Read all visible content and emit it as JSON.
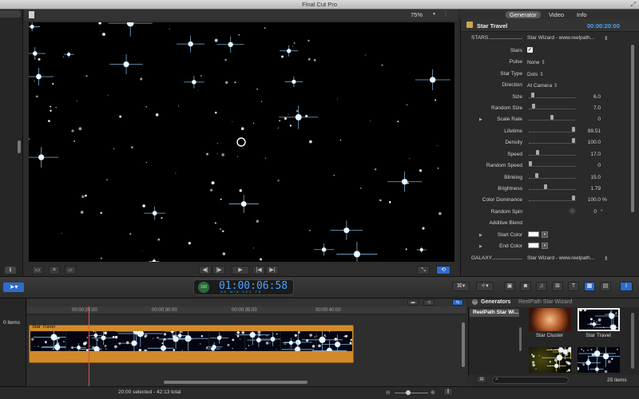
{
  "window": {
    "title": "Final Cut Pro"
  },
  "viewer": {
    "zoom": "75%"
  },
  "inspector": {
    "tabs": [
      {
        "label": "Generator",
        "active": true
      },
      {
        "label": "Video",
        "active": false
      },
      {
        "label": "Info",
        "active": false
      }
    ],
    "title": "Star Travel",
    "timecode": "00:00:20:00",
    "stars_section": {
      "label": "STARS",
      "value": "Star Wizard - www.reelpath..."
    },
    "galaxy_section": {
      "label": "GALAXY",
      "value": "Star Wizard - www.reelpath..."
    },
    "params": {
      "stars": {
        "label": "Stars",
        "checked": true
      },
      "pulse": {
        "label": "Pulse",
        "value": "None"
      },
      "star_type": {
        "label": "Star Type",
        "value": "Dots"
      },
      "direction": {
        "label": "Direction",
        "value": "At Camera"
      },
      "size": {
        "label": "Size",
        "value": "6.0",
        "fraction": 0.06
      },
      "random_size": {
        "label": "Random Size",
        "value": "7.0",
        "fraction": 0.07
      },
      "scale_rate": {
        "label": "Scale Rate",
        "value": "0",
        "fraction": 0.5
      },
      "lifetime": {
        "label": "Lifetime",
        "value": "99.51",
        "fraction": 0.995
      },
      "density": {
        "label": "Density",
        "value": "100.0",
        "fraction": 1.0
      },
      "speed": {
        "label": "Speed",
        "value": "17.0",
        "fraction": 0.17
      },
      "random_speed": {
        "label": "Random Speed",
        "value": "0",
        "fraction": 0.0
      },
      "blinking": {
        "label": "Blinking",
        "value": "15.0",
        "fraction": 0.15
      },
      "brightness": {
        "label": "Brightness",
        "value": "1.79",
        "fraction": 0.36
      },
      "color_dominance": {
        "label": "Color Dominance",
        "value": "100.0",
        "unit": "%",
        "fraction": 1.0
      },
      "random_spin": {
        "label": "Random Spin",
        "value": "0",
        "unit": "°"
      },
      "additive_blend": {
        "label": "Additive Blend",
        "checked": false
      },
      "start_color": {
        "label": "Start Color",
        "color": "#ffffff"
      },
      "end_color": {
        "label": "End Color",
        "color": "#ffffff"
      }
    }
  },
  "dashboard": {
    "badge": "100",
    "timecode": "01:00:06:58",
    "units": "HR MIN SEC FR"
  },
  "timeline": {
    "items_count": "0 items",
    "ruler": [
      "00:00:25:00",
      "00:00:30:00",
      "00:00:35:00",
      "00:00:40:00"
    ],
    "clip": {
      "label": "Star Travel"
    }
  },
  "browser": {
    "title": "Generators",
    "subtitle": "ReelPath Star Wizard",
    "category": "ReelPath Star Wi...",
    "thumbs": [
      {
        "label": "Star Cluster",
        "selected": false
      },
      {
        "label": "Star Travel",
        "selected": true
      },
      {
        "label": "",
        "selected": false
      },
      {
        "label": "",
        "selected": false
      }
    ],
    "count": "25 items"
  },
  "status": {
    "text": "20:00 selected - 42:13 total"
  },
  "colors": {
    "accent": "#2b6ccc",
    "timecode": "#4aa3ff",
    "clip": "#d08a2c",
    "playhead": "#e05050"
  }
}
